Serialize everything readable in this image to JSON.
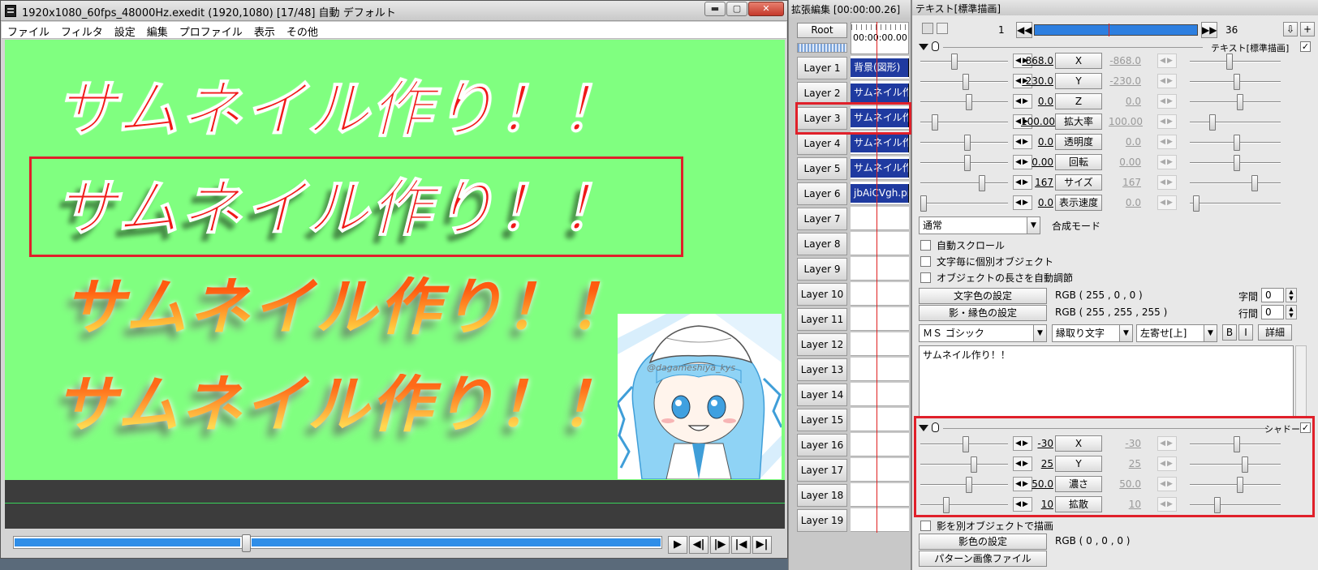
{
  "main_window": {
    "title": "1920x1080_60fps_48000Hz.exedit (1920,1080)  [17/48]  自動  デフォルト",
    "controls": {
      "minimize": "▬",
      "maximize": "▢",
      "close": "✕"
    },
    "menu": [
      "ファイル",
      "フィルタ",
      "設定",
      "編集",
      "プロファイル",
      "表示",
      "その他"
    ],
    "canvas": {
      "bg_color": "#80ff80",
      "texts": [
        "サムネイル作り！！",
        "サムネイル作り！！",
        "サムネイル作り！！",
        "サムネイル作り！！"
      ],
      "image_caption": "@dagameshiya_kys"
    },
    "playback": {
      "seek_position": 0.35,
      "buttons": [
        "▶",
        "◀|",
        "|▶",
        "|◀",
        "▶|"
      ]
    }
  },
  "timeline": {
    "title": "拡張編集 [00:00:00.26]",
    "root_label": "Root",
    "timecode": "00:00:00.00",
    "layers": [
      {
        "label": "Layer 1",
        "clip": "背景(図形)"
      },
      {
        "label": "Layer 2",
        "clip": "サムネイル作"
      },
      {
        "label": "Layer 3",
        "clip": "サムネイル作"
      },
      {
        "label": "Layer 4",
        "clip": "サムネイル作"
      },
      {
        "label": "Layer 5",
        "clip": "サムネイル作"
      },
      {
        "label": "Layer 6",
        "clip": "jbAiCVgh.pn"
      },
      {
        "label": "Layer 7",
        "clip": ""
      },
      {
        "label": "Layer 8",
        "clip": ""
      },
      {
        "label": "Layer 9",
        "clip": ""
      },
      {
        "label": "Layer 10",
        "clip": ""
      },
      {
        "label": "Layer 11",
        "clip": ""
      },
      {
        "label": "Layer 12",
        "clip": ""
      },
      {
        "label": "Layer 13",
        "clip": ""
      },
      {
        "label": "Layer 14",
        "clip": ""
      },
      {
        "label": "Layer 15",
        "clip": ""
      },
      {
        "label": "Layer 16",
        "clip": ""
      },
      {
        "label": "Layer 17",
        "clip": ""
      },
      {
        "label": "Layer 18",
        "clip": ""
      },
      {
        "label": "Layer 19",
        "clip": ""
      }
    ]
  },
  "properties": {
    "title": "テキスト[標準描画]",
    "frame_start": "1",
    "frame_end": "36",
    "section_text": {
      "name": "テキスト[標準描画]",
      "rows": [
        {
          "label": "X",
          "value": "-868.0",
          "end": "-868.0"
        },
        {
          "label": "Y",
          "value": "-230.0",
          "end": "-230.0"
        },
        {
          "label": "Z",
          "value": "0.0",
          "end": "0.0"
        },
        {
          "label": "拡大率",
          "value": "100.00",
          "end": "100.00"
        },
        {
          "label": "透明度",
          "value": "0.0",
          "end": "0.0"
        },
        {
          "label": "回転",
          "value": "0.00",
          "end": "0.00"
        },
        {
          "label": "サイズ",
          "value": "167",
          "end": "167"
        },
        {
          "label": "表示速度",
          "value": "0.0",
          "end": "0.0"
        }
      ]
    },
    "blend_mode": {
      "value": "通常",
      "label": "合成モード"
    },
    "checkboxes": [
      "自動スクロール",
      "文字毎に個別オブジェクト",
      "オブジェクトの長さを自動調節"
    ],
    "text_color": {
      "button": "文字色の設定",
      "value": "RGB ( 255 , 0 , 0 )"
    },
    "shadow_color": {
      "button": "影・縁色の設定",
      "value": "RGB ( 255 , 255 , 255 )"
    },
    "char_spacing": {
      "label": "字間",
      "value": "0"
    },
    "line_spacing": {
      "label": "行間",
      "value": "0"
    },
    "font": "ＭＳ ゴシック",
    "decoration": "縁取り文字",
    "align": "左寄せ[上]",
    "bold": "B",
    "italic": "I",
    "detail": "詳細",
    "text_content": "サムネイル作り！！",
    "section_shadow": {
      "name": "シャドー",
      "rows": [
        {
          "label": "X",
          "value": "-30",
          "end": "-30"
        },
        {
          "label": "Y",
          "value": "25",
          "end": "25"
        },
        {
          "label": "濃さ",
          "value": "50.0",
          "end": "50.0"
        },
        {
          "label": "拡散",
          "value": "10",
          "end": "10"
        }
      ]
    },
    "shadow_separate": "影を別オブジェクトで描画",
    "shadow_color_btn": {
      "button": "影色の設定",
      "value": "RGB ( 0 , 0 , 0 )"
    },
    "pattern_btn": "パターン画像ファイル",
    "accent_red": "#e0202a",
    "clip_blue": "#1f3aa0"
  }
}
